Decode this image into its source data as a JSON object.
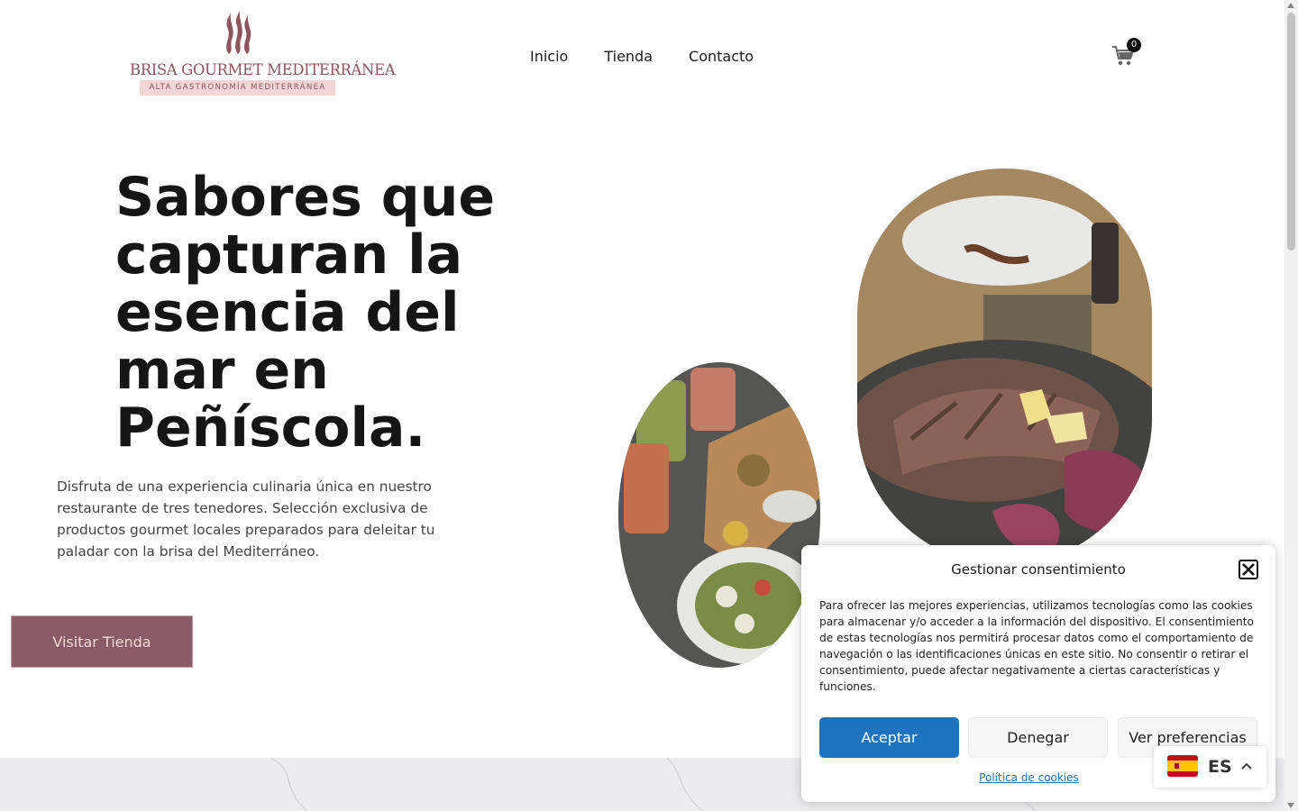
{
  "header": {
    "logo_name": "BRISA GOURMET MEDITERRÁNEA",
    "logo_tagline": "ALTA GASTRONOMÍA MEDITERRÁNEA",
    "nav": [
      "Inicio",
      "Tienda",
      "Contacto"
    ],
    "cart_count": "0",
    "cart_icon": "shopping-cart-icon"
  },
  "hero": {
    "title": "Sabores que capturan la esencia del mar en Peñíscola.",
    "text": "Disfruta de una experiencia culinaria única en nuestro restaurante de tres tenedores. Selección exclusiva de productos gourmet locales preparados para deleitar tu paladar con la brisa del Mediterráneo.",
    "button": "Visitar Tienda"
  },
  "cookie": {
    "title": "Gestionar consentimiento",
    "body": "Para ofrecer las mejores experiencias, utilizamos tecnologías como las cookies para almacenar y/o acceder a la información del dispositivo. El consentimiento de estas tecnologías nos permitirá procesar datos como el comportamiento de navegación o las identificaciones únicas en este sitio. No consentir o retirar el consentimiento, puede afectar negativamente a ciertas características y funciones.",
    "accept": "Aceptar",
    "deny": "Denegar",
    "preferences": "Ver preferencias",
    "policy_link": "Política de cookies"
  },
  "language": {
    "code": "ES",
    "flag": "spain-flag-icon"
  },
  "colors": {
    "brand": "#8a5a66",
    "accent_blue": "#1e73be",
    "logo_text": "#8e5560"
  }
}
